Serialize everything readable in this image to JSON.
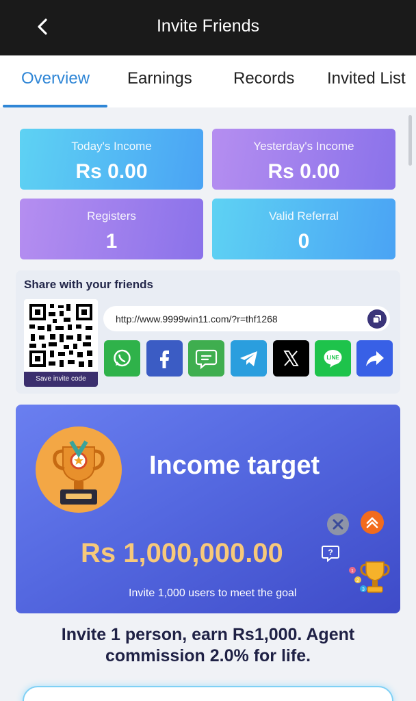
{
  "header": {
    "title": "Invite Friends",
    "back_icon": "chevron-left-icon"
  },
  "tabs": [
    {
      "label": "Overview",
      "active": true
    },
    {
      "label": "Earnings",
      "active": false
    },
    {
      "label": "Records",
      "active": false
    },
    {
      "label": "Invited List",
      "active": false
    }
  ],
  "stats": {
    "today": {
      "label": "Today's Income",
      "value": "Rs 0.00"
    },
    "yesterday": {
      "label": "Yesterday's Income",
      "value": "Rs 0.00"
    },
    "registers": {
      "label": "Registers",
      "value": "1"
    },
    "valid_referral": {
      "label": "Valid Referral",
      "value": "0"
    }
  },
  "share": {
    "title": "Share with your friends",
    "save_label": "Save invite code",
    "link": "http://www.9999win11.com/?r=thf1268",
    "socials": [
      {
        "name": "whatsapp-icon",
        "color": "#2fb24a"
      },
      {
        "name": "facebook-icon",
        "color": "#3b5cc4"
      },
      {
        "name": "sms-icon",
        "color": "#3fae4f"
      },
      {
        "name": "telegram-icon",
        "color": "#2a9ede"
      },
      {
        "name": "x-icon",
        "color": "#000000"
      },
      {
        "name": "line-icon",
        "color": "#1ec34b"
      },
      {
        "name": "share-icon",
        "color": "#3860e6"
      }
    ]
  },
  "income": {
    "title": "Income target",
    "amount": "Rs 1,000,000.00",
    "goal": "Invite 1,000 users to meet the goal"
  },
  "promo": {
    "line1": "Invite 1 person, earn Rs1,000. Agent",
    "line2": "commission 2.0% for life."
  },
  "colors": {
    "accent": "#2f86d6",
    "header": "#1a1a1a",
    "amount": "#f7c97a"
  }
}
